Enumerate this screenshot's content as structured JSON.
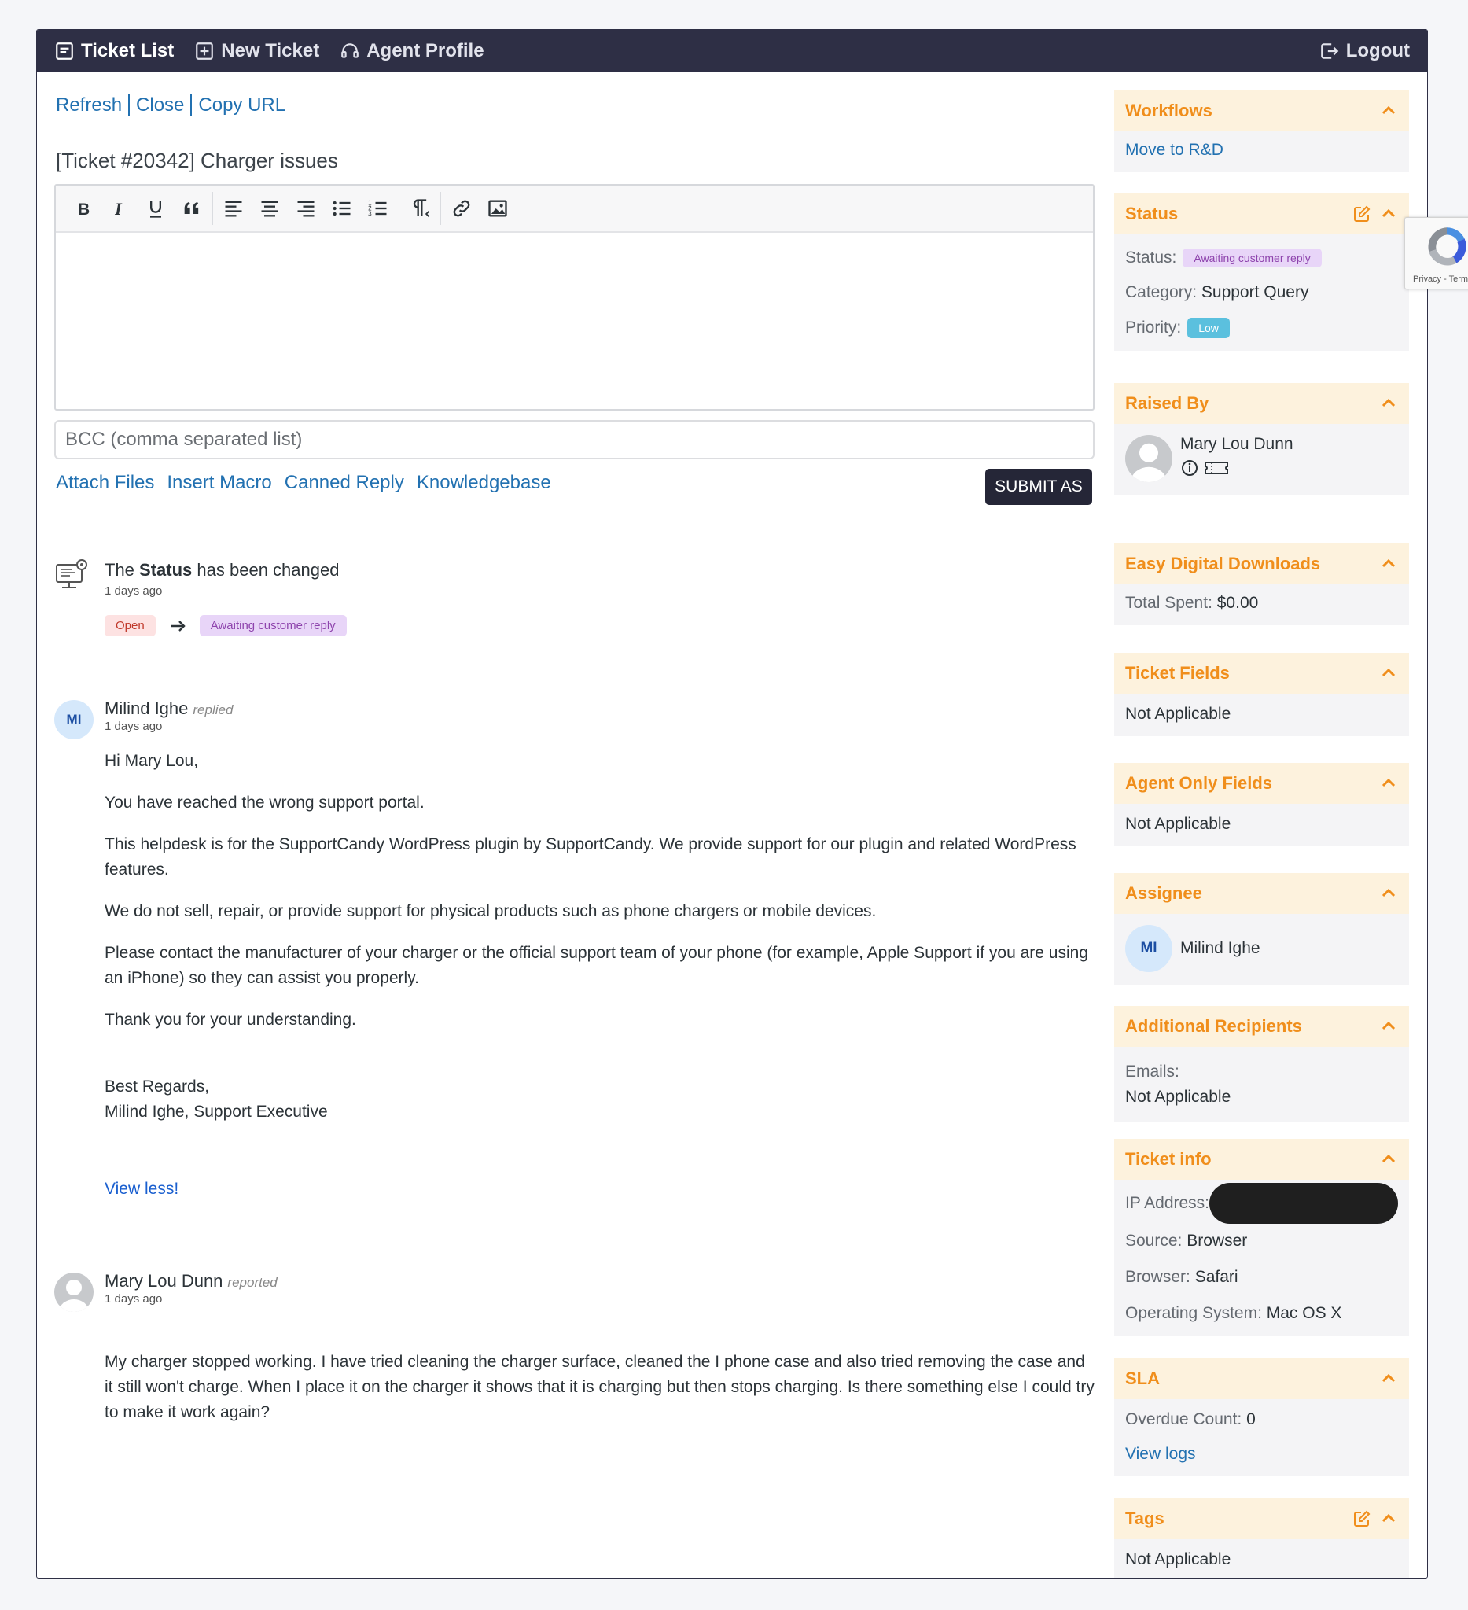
{
  "nav": {
    "ticket_list": "Ticket List",
    "new_ticket": "New Ticket",
    "agent_profile": "Agent Profile",
    "logout": "Logout"
  },
  "actions": {
    "refresh": "Refresh",
    "close": "Close",
    "copy_url": "Copy URL"
  },
  "ticket": {
    "subject": "[Ticket #20342] Charger issues"
  },
  "editor": {
    "toolbar": [
      "bold-icon",
      "italic-icon",
      "underline-icon",
      "blockquote-icon",
      "align-left-icon",
      "align-center-icon",
      "align-right-icon",
      "bullet-list-icon",
      "numbered-list-icon",
      "rtl-icon",
      "link-icon",
      "image-icon"
    ],
    "bcc_placeholder": "BCC (comma separated list)",
    "attach_files": "Attach Files",
    "insert_macro": "Insert Macro",
    "canned_reply": "Canned Reply",
    "knowledgebase": "Knowledgebase",
    "submit_label": "SUBMIT AS"
  },
  "thread": {
    "log": {
      "prefix": "The",
      "field": "Status",
      "suffix": "has been changed",
      "time": "1 days ago",
      "from": "Open",
      "to": "Awaiting customer reply"
    },
    "reply": {
      "initials": "MI",
      "author": "Milind Ighe",
      "action": "replied",
      "time": "1 days ago",
      "paragraphs": [
        "Hi Mary Lou,",
        "You have reached the wrong support portal.",
        "This helpdesk is for the SupportCandy WordPress plugin by SupportCandy. We provide support for our plugin and related WordPress features.",
        "We do not sell, repair, or provide support for physical products such as phone chargers or mobile devices.",
        "Please contact the manufacturer of your charger or the official support team of your phone (for example, Apple Support if you are using an iPhone) so they can assist you properly.",
        "Thank you for your understanding."
      ],
      "regards": "Best Regards,",
      "signature": "Milind Ighe, Support Executive",
      "view_less": "View less!"
    },
    "report": {
      "author": "Mary Lou Dunn",
      "action": "reported",
      "time": "1 days ago",
      "text": "My charger stopped working. I have tried cleaning the charger surface, cleaned the I phone case and also tried removing the case and it still won't charge. When I place it on the charger it shows that it is charging but then stops charging. Is there something else I could try to make it work again?"
    }
  },
  "sidebar": {
    "workflows": {
      "title": "Workflows",
      "link": "Move to R&D"
    },
    "status": {
      "title": "Status",
      "status_label": "Status:",
      "status_value": "Awaiting customer reply",
      "category_label": "Category:",
      "category_value": "Support Query",
      "priority_label": "Priority:",
      "priority_value": "Low"
    },
    "raised_by": {
      "title": "Raised By",
      "name": "Mary Lou Dunn"
    },
    "edd": {
      "title": "Easy Digital Downloads",
      "label": "Total Spent:",
      "value": "$0.00"
    },
    "ticket_fields": {
      "title": "Ticket Fields",
      "value": "Not Applicable"
    },
    "agent_only_fields": {
      "title": "Agent Only Fields",
      "value": "Not Applicable"
    },
    "assignee": {
      "title": "Assignee",
      "initials": "MI",
      "name": "Milind Ighe"
    },
    "additional_recipients": {
      "title": "Additional Recipients",
      "label": "Emails:",
      "value": "Not Applicable"
    },
    "ticket_info": {
      "title": "Ticket info",
      "ip_label": "IP Address:",
      "source_label": "Source:",
      "source_value": "Browser",
      "browser_label": "Browser:",
      "browser_value": "Safari",
      "os_label": "Operating System:",
      "os_value": "Mac OS X"
    },
    "sla": {
      "title": "SLA",
      "label": "Overdue Count:",
      "value": "0",
      "link": "View logs"
    },
    "tags": {
      "title": "Tags",
      "value": "Not Applicable"
    }
  },
  "recaptcha": {
    "text": "Privacy - Terms"
  },
  "colors": {
    "nav_bg": "#2e2f45",
    "accent_orange": "#f08e1b",
    "link_blue": "#2271b1",
    "priority_low": "#5bc0de"
  }
}
